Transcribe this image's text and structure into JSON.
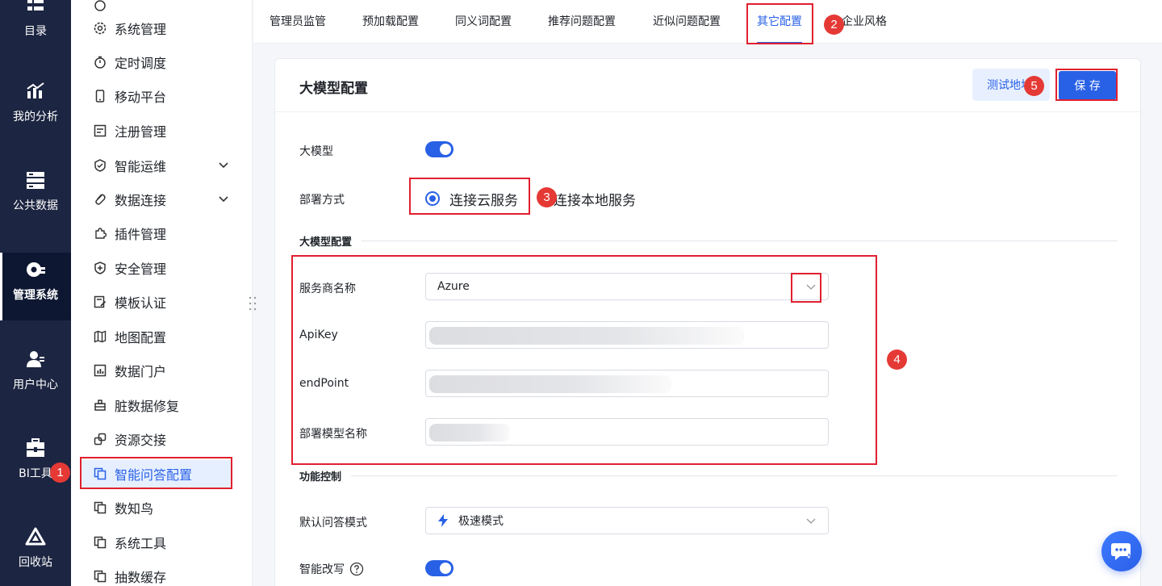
{
  "leftnav": {
    "items": [
      {
        "label": "目录",
        "icon": "catalog-icon"
      },
      {
        "label": "我的分析",
        "icon": "analysis-icon"
      },
      {
        "label": "公共数据",
        "icon": "database-icon"
      },
      {
        "label": "管理系统",
        "icon": "gear-icon"
      },
      {
        "label": "用户中心",
        "icon": "user-icon"
      },
      {
        "label": "BI工具",
        "icon": "toolbox-icon"
      },
      {
        "label": "回收站",
        "icon": "recycle-icon"
      }
    ]
  },
  "submenu": {
    "items": [
      {
        "label": "系统管理",
        "icon": "settings-icon"
      },
      {
        "label": "定时调度",
        "icon": "timer-icon"
      },
      {
        "label": "移动平台",
        "icon": "mobile-icon"
      },
      {
        "label": "注册管理",
        "icon": "register-icon"
      },
      {
        "label": "智能运维",
        "icon": "ops-icon"
      },
      {
        "label": "数据连接",
        "icon": "link-icon"
      },
      {
        "label": "插件管理",
        "icon": "plugin-icon"
      },
      {
        "label": "安全管理",
        "icon": "shield-icon"
      },
      {
        "label": "模板认证",
        "icon": "template-icon"
      },
      {
        "label": "地图配置",
        "icon": "map-icon"
      },
      {
        "label": "数据门户",
        "icon": "portal-icon"
      },
      {
        "label": "脏数据修复",
        "icon": "repair-icon"
      },
      {
        "label": "资源交接",
        "icon": "resource-icon"
      },
      {
        "label": "智能问答配置",
        "icon": "copy-icon"
      },
      {
        "label": "数知鸟",
        "icon": "copy-icon"
      },
      {
        "label": "系统工具",
        "icon": "copy-icon"
      },
      {
        "label": "抽数缓存",
        "icon": "copy-icon"
      }
    ]
  },
  "tabs": [
    "管理员监管",
    "预加载配置",
    "同义词配置",
    "推荐问题配置",
    "近似问题配置",
    "其它配置",
    "企业风格"
  ],
  "card": {
    "title": "大模型配置",
    "test_label": "测试地址",
    "save_label": "保 存",
    "llm_label": "大模型",
    "deploy_label": "部署方式",
    "deploy_cloud": "连接云服务",
    "deploy_local": "连接本地服务",
    "section_llm": "大模型配置",
    "provider_label": "服务商名称",
    "provider_value": "Azure",
    "apikey_label": "ApiKey",
    "endpoint_label": "endPoint",
    "model_label": "部署模型名称",
    "section_func": "功能控制",
    "mode_label": "默认问答模式",
    "mode_value": "极速模式",
    "rewrite_label": "智能改写"
  },
  "badges": [
    "1",
    "2",
    "3",
    "4",
    "5"
  ],
  "colors": {
    "primary": "#2961e6",
    "nav_bg": "#1c2541",
    "highlight": "#e0202f"
  }
}
